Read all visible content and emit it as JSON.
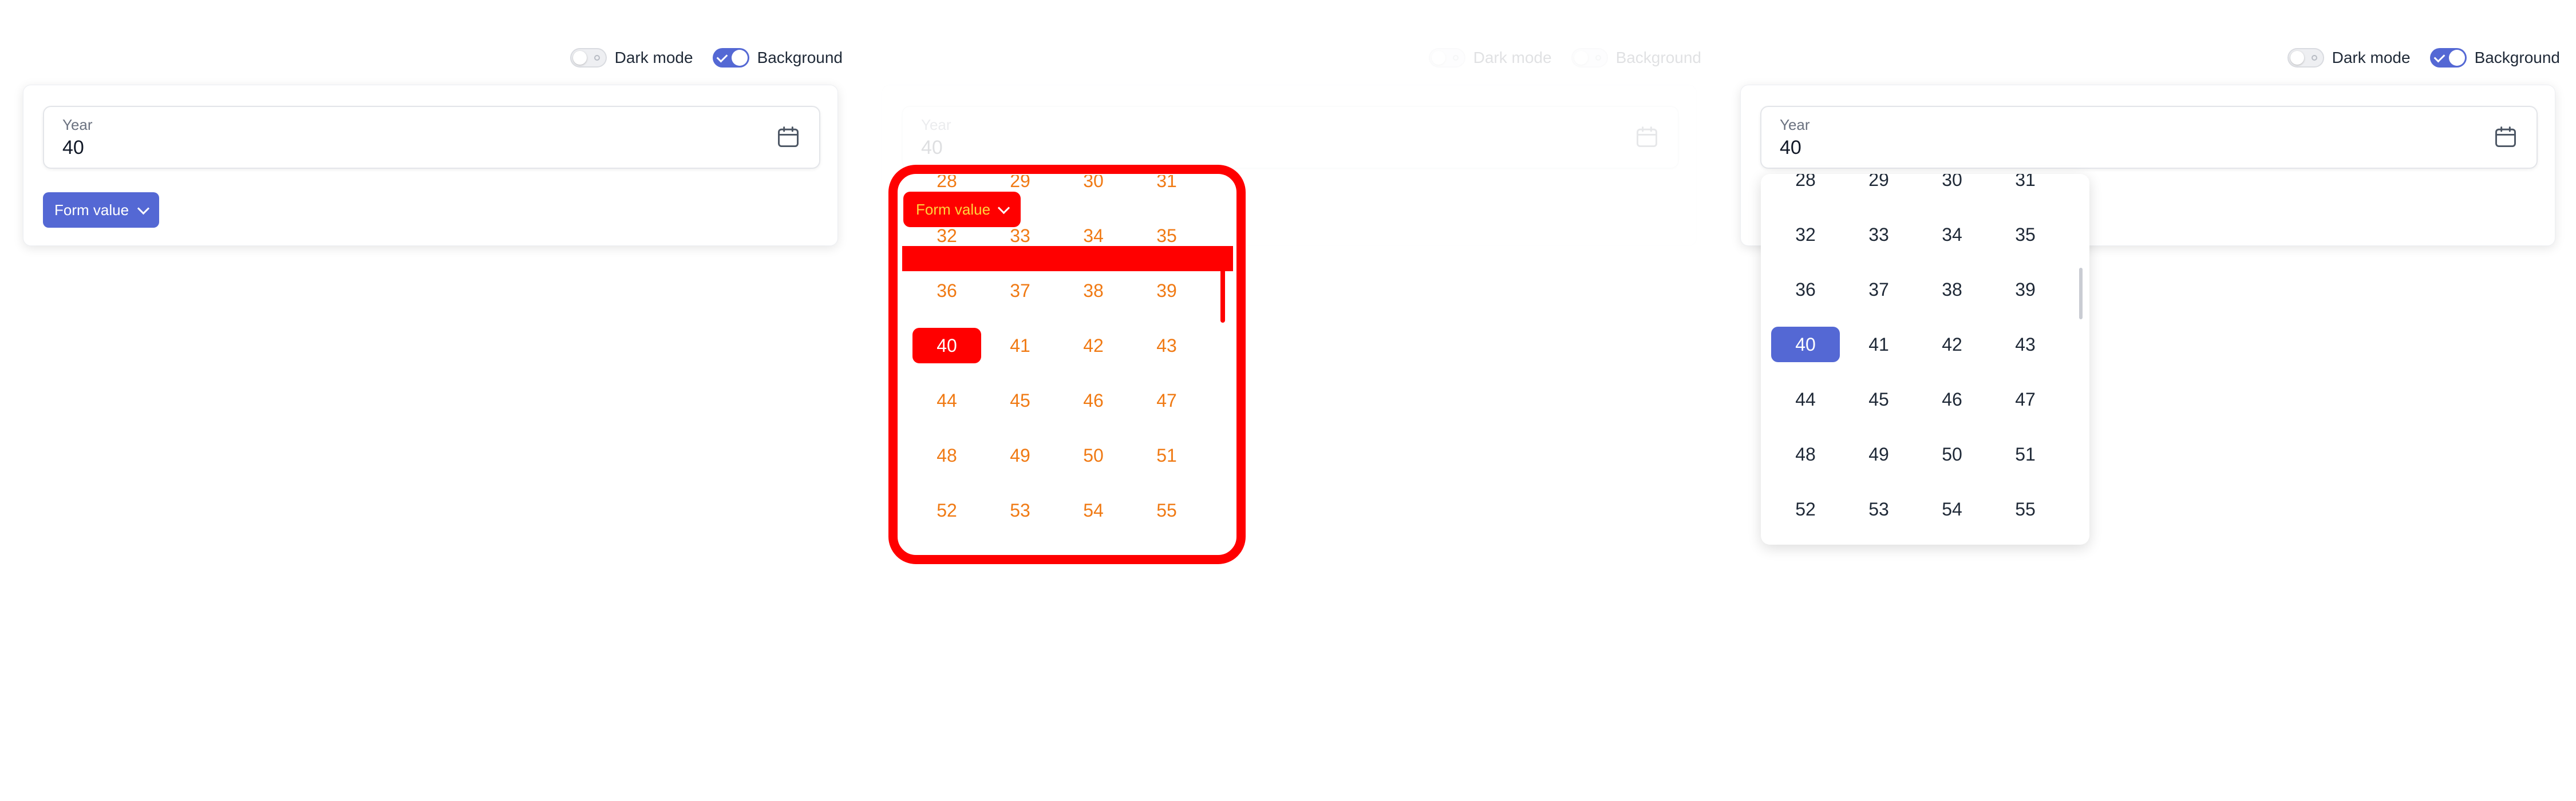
{
  "toggles": {
    "dark_mode": "Dark mode",
    "background": "Background"
  },
  "field": {
    "label": "Year",
    "value": "40"
  },
  "button": {
    "label": "Form value"
  },
  "years": [
    "28",
    "29",
    "30",
    "31",
    "32",
    "33",
    "34",
    "35",
    "36",
    "37",
    "38",
    "39",
    "40",
    "41",
    "42",
    "43",
    "44",
    "45",
    "46",
    "47",
    "48",
    "49",
    "50",
    "51",
    "52",
    "53",
    "54",
    "55"
  ],
  "selected_year": "40",
  "colors": {
    "accent": "#5468d4",
    "overlay_red": "#ff0000",
    "overlay_text": "#f07a14"
  }
}
